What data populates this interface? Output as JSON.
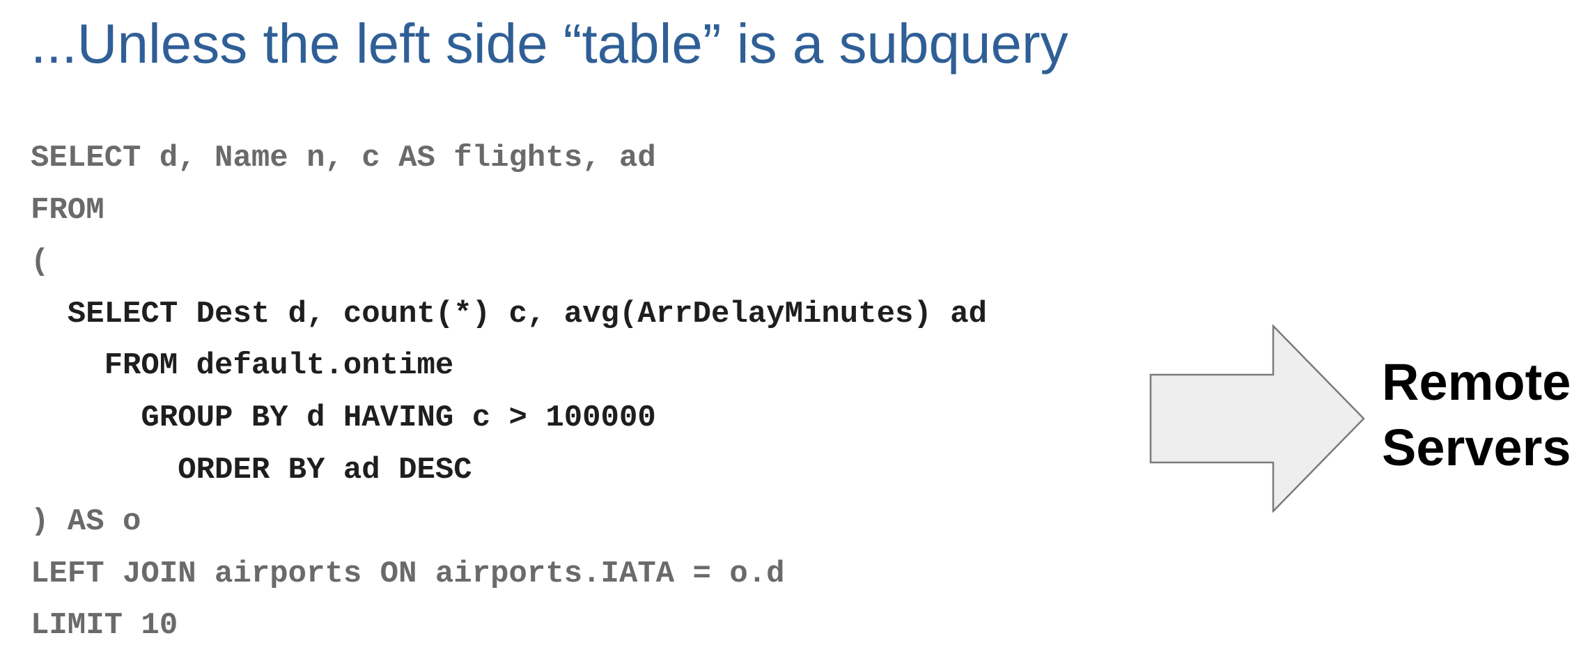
{
  "slide": {
    "title": "...Unless the left side “table” is a subquery",
    "code_lines": [
      {
        "text": "SELECT d, Name n, c AS flights, ad",
        "style": "outer"
      },
      {
        "text": "FROM",
        "style": "outer"
      },
      {
        "text": "(",
        "style": "outer"
      },
      {
        "text": "  SELECT Dest d, count(*) c, avg(ArrDelayMinutes) ad",
        "style": "inner"
      },
      {
        "text": "    FROM default.ontime",
        "style": "inner"
      },
      {
        "text": "      GROUP BY d HAVING c > 100000",
        "style": "inner"
      },
      {
        "text": "        ORDER BY ad DESC",
        "style": "inner"
      },
      {
        "text": ") AS o",
        "style": "outer"
      },
      {
        "text": "LEFT JOIN airports ON airports.IATA = o.d",
        "style": "outer"
      },
      {
        "text": "LIMIT 10",
        "style": "outer"
      }
    ],
    "arrow": {
      "icon": "right-arrow-icon",
      "fill": "#eeeeee",
      "stroke": "#7a7a7a"
    },
    "remote_label": {
      "line1": "Remote",
      "line2": "Servers"
    },
    "colors": {
      "title": "#2f5f96",
      "outer_code": "#6a6a6a",
      "inner_code": "#1e1e1e"
    }
  }
}
